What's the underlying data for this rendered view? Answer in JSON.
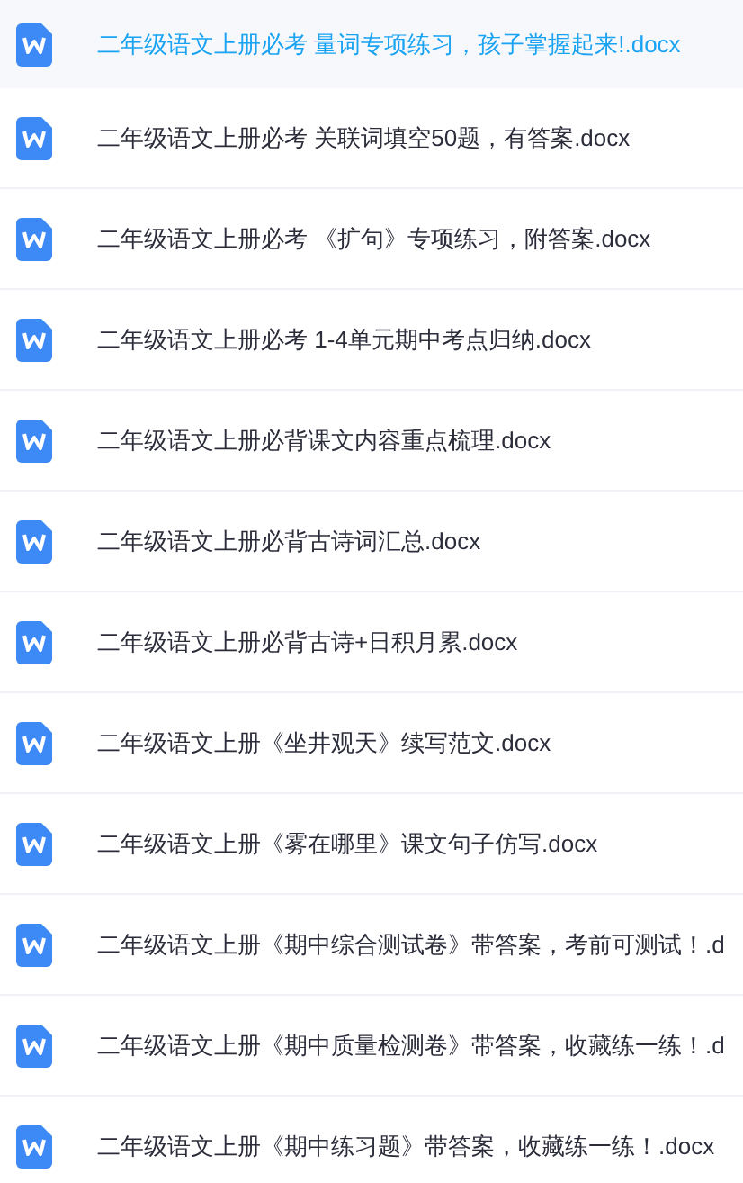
{
  "files": [
    {
      "name": "二年级语文上册必考 量词专项练习，孩子掌握起来!.docx",
      "selected": true
    },
    {
      "name": "二年级语文上册必考 关联词填空50题，有答案.docx",
      "selected": false
    },
    {
      "name": "二年级语文上册必考 《扩句》专项练习，附答案.docx",
      "selected": false
    },
    {
      "name": "二年级语文上册必考 1-4单元期中考点归纳.docx",
      "selected": false
    },
    {
      "name": "二年级语文上册必背课文内容重点梳理.docx",
      "selected": false
    },
    {
      "name": "二年级语文上册必背古诗词汇总.docx",
      "selected": false
    },
    {
      "name": "二年级语文上册必背古诗+日积月累.docx",
      "selected": false
    },
    {
      "name": "二年级语文上册《坐井观天》续写范文.docx",
      "selected": false
    },
    {
      "name": "二年级语文上册《雾在哪里》课文句子仿写.docx",
      "selected": false
    },
    {
      "name": "二年级语文上册《期中综合测试卷》带答案，考前可测试！.d",
      "selected": false
    },
    {
      "name": "二年级语文上册《期中质量检测卷》带答案，收藏练一练！.d",
      "selected": false
    },
    {
      "name": "二年级语文上册《期中练习题》带答案，收藏练一练！.docx",
      "selected": false
    }
  ]
}
